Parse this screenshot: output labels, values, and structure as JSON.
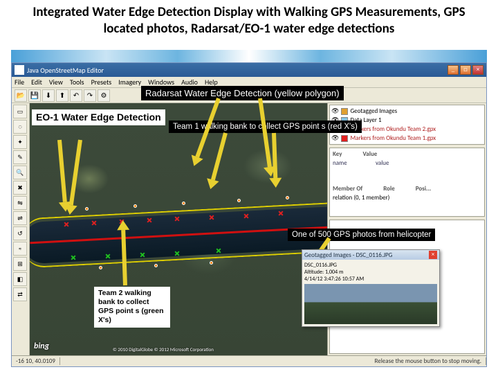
{
  "slide": {
    "title": "Integrated Water Edge Detection Display with Walking GPS Measurements, GPS located photos, Radarsat/EO-1 water edge detections"
  },
  "window": {
    "title": "Java OpenStreetMap Editor",
    "menu": [
      "File",
      "Edit",
      "View",
      "Tools",
      "Presets",
      "Imagery",
      "Windows",
      "Audio",
      "Help"
    ],
    "min": "_",
    "max": "□",
    "close": "×"
  },
  "layers": {
    "l1": "Geotagged Images",
    "l2": "Data Layer 1",
    "l3": "Markers from Okundu Team 2.gpx",
    "l4": "Markers from Okundu Team 1.gpx"
  },
  "props": {
    "key_h": "Key",
    "val_h": "Value",
    "k1": "name",
    "v1": "value",
    "mem_h": "Member Of",
    "role_h": "Role",
    "pos_h": "Posi...",
    "m1": "relation (0, 1 member)"
  },
  "status": {
    "coord": "-16 10, 40.0109",
    "hint": "Release the mouse button to stop moving."
  },
  "callouts": {
    "radarsat": "Radarsat Water Edge Detection (yellow polygon)",
    "eo1": "EO-1 Water Edge Detection",
    "team1": "Team 1 walking bank to collect  GPS point s (red X's)",
    "team2": "Team 2 walking bank to collect  GPS point s (green X's)",
    "photo": "One of 500 GPS photos from helicopter"
  },
  "popup": {
    "title": "Geotagged Images - DSC_0116.JPG",
    "line1": "DSC_0116.JPG",
    "line2": "Altitude: 1,004 m",
    "line3": "4/14/12 3:47:26 10:57 AM",
    "close": "×"
  },
  "map": {
    "bing": "bing",
    "credit": "© 2010 DigitalGlobe © 2012 Microsoft Corporation"
  }
}
